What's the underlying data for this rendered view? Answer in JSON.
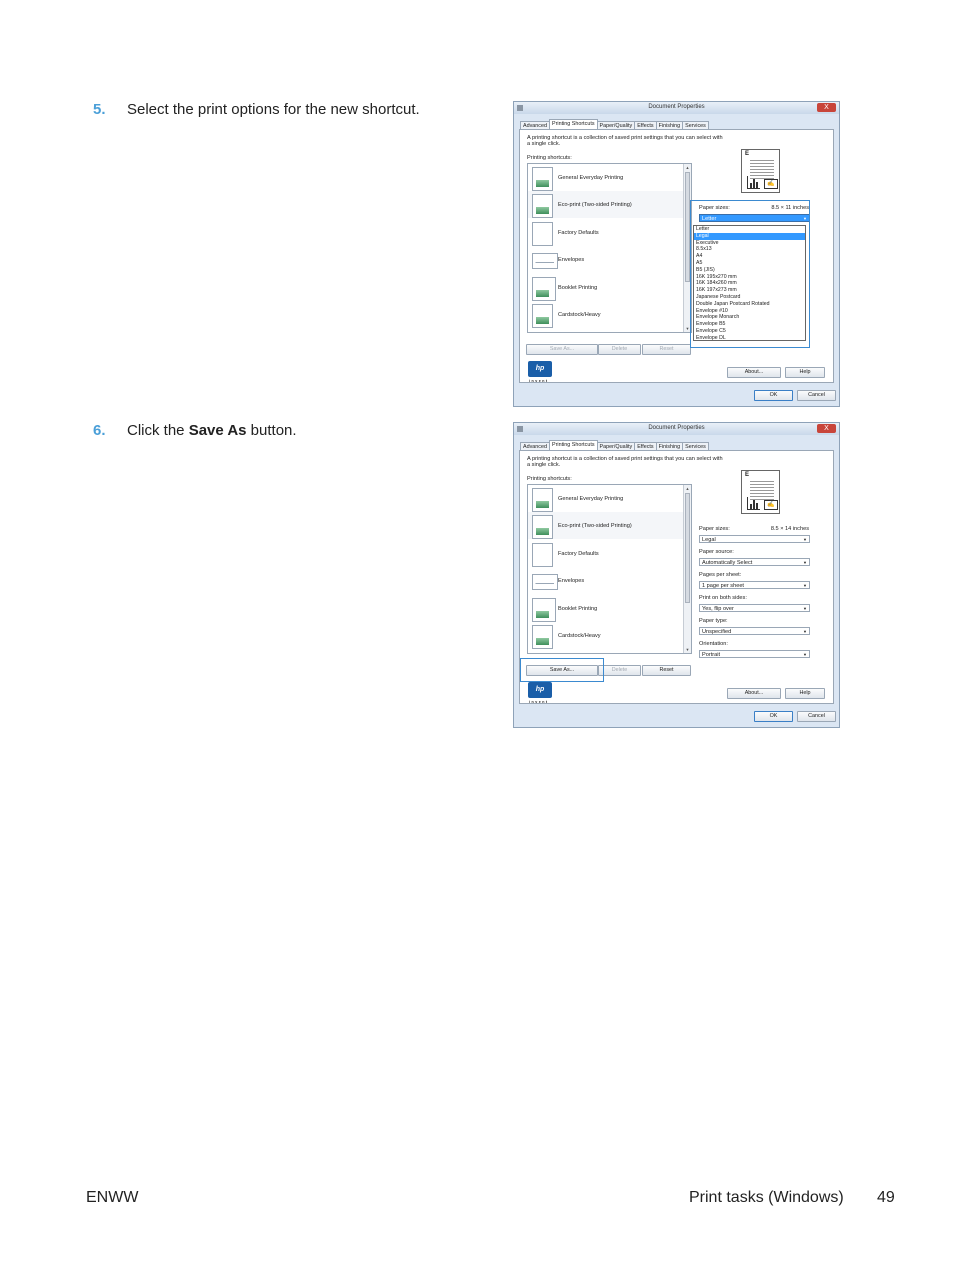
{
  "steps": [
    {
      "number": "5.",
      "text": "Select the print options for the new shortcut."
    },
    {
      "number": "6.",
      "text_before": "Click the ",
      "bold": "Save As",
      "text_after": " button."
    }
  ],
  "dialog": {
    "title": "Document Properties",
    "close": "X",
    "tabs": [
      "Advanced",
      "Printing Shortcuts",
      "Paper/Quality",
      "Effects",
      "Finishing",
      "Services"
    ],
    "description": "A printing shortcut is a collection of saved print settings that you can select with a single click.",
    "shortcuts_label": "Printing shortcuts:",
    "shortcuts": [
      "General Everyday Printing",
      "Eco-print (Two-sided Printing)",
      "Factory Defaults",
      "Envelopes",
      "Booklet Printing",
      "Cardstock/Heavy"
    ],
    "buttons": {
      "save_as": "Save As...",
      "delete": "Delete",
      "reset": "Reset",
      "about": "About...",
      "help": "Help",
      "ok": "OK",
      "cancel": "Cancel"
    },
    "hp_logo": "hp",
    "hp_tag": "invent"
  },
  "dialog1": {
    "paper_sizes_label": "Paper sizes:",
    "paper_sizes_value": "8.5 × 11 inches",
    "paper_size_selected": "Letter",
    "dropdown_options": [
      "Letter",
      "Legal",
      "Executive",
      "8.5x13",
      "A4",
      "A5",
      "B5 (JIS)",
      "16K 195x270 mm",
      "16K 184x260 mm",
      "16K 197x273 mm",
      "Japanese Postcard",
      "Double Japan Postcard Rotated",
      "Envelope #10",
      "Envelope Monarch",
      "Envelope B5",
      "Envelope C5",
      "Envelope DL"
    ],
    "dropdown_highlight": "Legal"
  },
  "dialog2": {
    "fields": [
      {
        "label": "Paper sizes:",
        "extra": "8.5 × 14 inches",
        "value": "Legal"
      },
      {
        "label": "Paper source:",
        "extra": "",
        "value": "Automatically Select"
      },
      {
        "label": "Pages per sheet:",
        "extra": "",
        "value": "1 page per sheet"
      },
      {
        "label": "Print on both sides:",
        "extra": "",
        "value": "Yes, flip over"
      },
      {
        "label": "Paper type:",
        "extra": "",
        "value": "Unspecified"
      },
      {
        "label": "Orientation:",
        "extra": "",
        "value": "Portrait"
      }
    ]
  },
  "footer": {
    "left": "ENWW",
    "section": "Print tasks (Windows)",
    "page": "49"
  },
  "colors": {
    "step_number": "#4a9fd8",
    "highlight_frame": "#3b8ad0",
    "selection": "#3399ff"
  }
}
